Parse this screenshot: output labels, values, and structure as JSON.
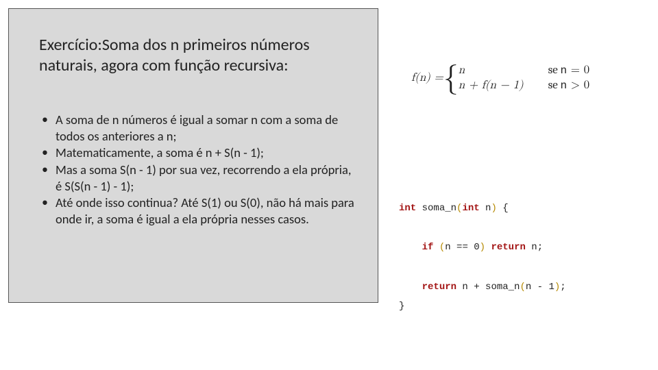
{
  "title": {
    "prefix": "Exercício:",
    "rest": "Soma dos n primeiros números naturais, agora com função recursiva:"
  },
  "bullets": [
    "A soma de n números é igual a somar n com a soma de todos os anteriores a n;",
    "Matematicamente, a soma é n + S(n - 1);",
    "Mas a soma S(n - 1) por sua vez, recorrendo a ela própria, é S(S(n - 1)  - 1);",
    "Até onde isso continua? Até S(1) ou S(0), não há mais para onde ir, a soma é igual a ela própria nesses casos."
  ],
  "formula": {
    "lhs": "f(n) = ",
    "case1_expr": "n",
    "case1_cond_word": "se ",
    "case1_cond_var": "n",
    "case1_cond_rest": " = 0",
    "case2_expr": "n + f(n − 1)",
    "case2_cond_word": "se ",
    "case2_cond_var": "n",
    "case2_cond_rest": " > 0"
  },
  "code": {
    "t_int": "int",
    "t_soma": " soma_n",
    "t_lpar": "(",
    "t_int2": "int",
    "t_n": " n",
    "t_rpar": ")",
    "t_lbrace": " {",
    "t_if": "if",
    "t_sp": " ",
    "t_lpar2": "(",
    "t_cond": "n == 0",
    "t_rpar2": ")",
    "t_ret1": "return",
    "t_ret1_val": " n;",
    "t_ret2": "return",
    "t_ret2_val": " n + soma_n",
    "t_lpar3": "(",
    "t_arg": "n - 1",
    "t_rpar3": ")",
    "t_semi": ";",
    "t_rbrace": "}"
  }
}
